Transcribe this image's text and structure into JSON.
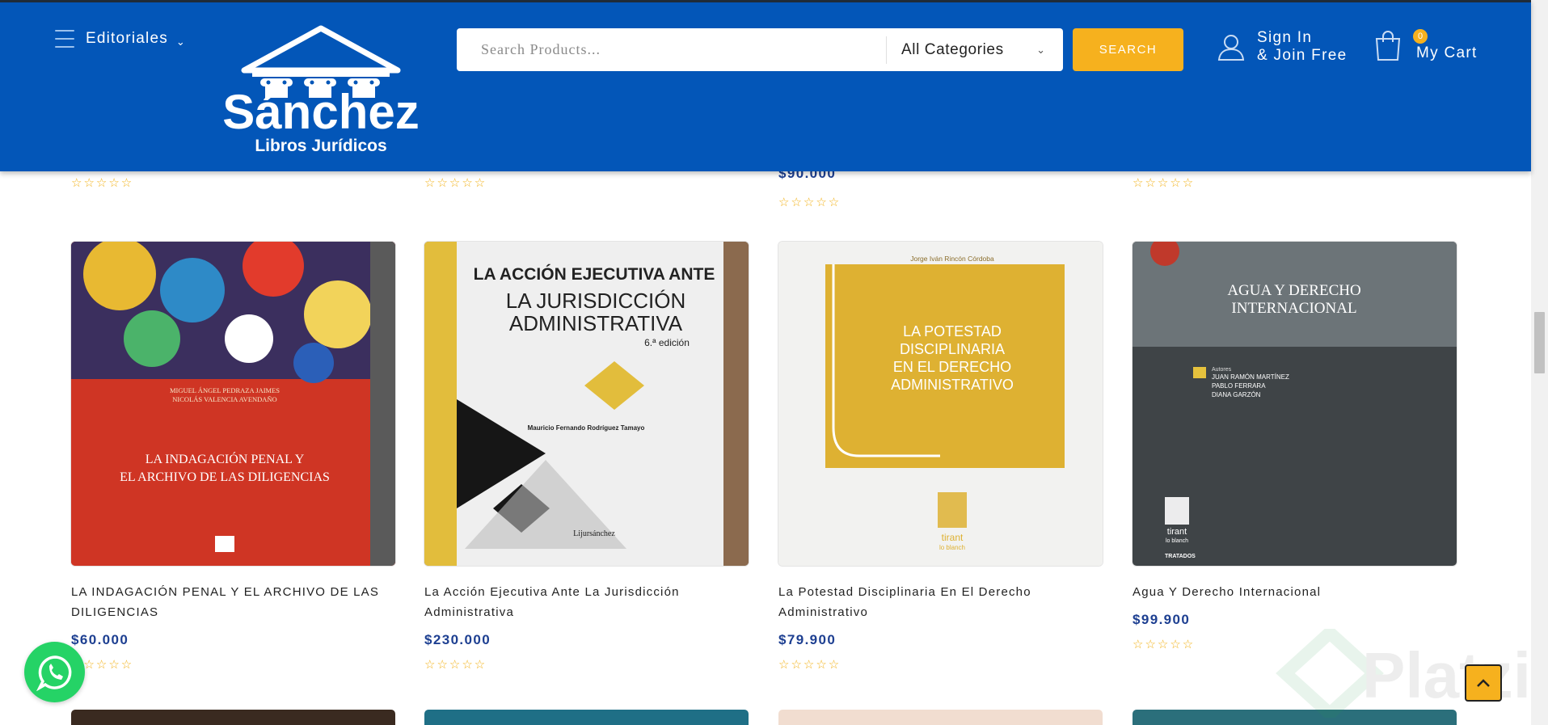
{
  "header": {
    "menu_label": "Editoriales",
    "logo": {
      "name": "Sánchez",
      "subtitle": "Libros Jurídicos"
    },
    "search_placeholder": "Search Products...",
    "category_selected": "All Categories",
    "search_button": "SEARCH",
    "account_line1": "Sign In",
    "account_line2": "& Join Free",
    "cart_count": "0",
    "cart_label": "My Cart",
    "colors": {
      "header_bg": "#0356b8",
      "accent": "#f6b11e",
      "price": "#1d3f91"
    }
  },
  "previous_row": {
    "price_visible": "$90.000",
    "rating_glyph": "☆☆☆☆☆"
  },
  "products": [
    {
      "title": "LA INDAGACIÓN PENAL Y EL ARCHIVO DE LAS DILIGENCIAS",
      "price": "$60.000",
      "rating": "☆☆☆☆☆",
      "cover_text": {
        "authors": "MIGUEL ÁNGEL PEDRAZA JAIMES\nNICOLÁS VALENCIA AVENDAÑO",
        "title": "LA INDAGACIÓN PENAL Y\nEL ARCHIVO DE LAS DILIGENCIAS"
      }
    },
    {
      "title": "La Acción Ejecutiva Ante La Jurisdicción Administrativa",
      "price": "$230.000",
      "rating": "☆☆☆☆☆",
      "cover_text": {
        "top": "LA ACCIÓN EJECUTIVA ANTE",
        "main": "LA JURISDICCIÓN\nADMINISTRATIVA",
        "edition": "6.ª edición",
        "author": "Mauricio Fernando Rodríguez Tamayo",
        "publisher": "Lijursánchez"
      }
    },
    {
      "title": "La Potestad Disciplinaria En El Derecho Administrativo",
      "price": "$79.900",
      "rating": "☆☆☆☆☆",
      "cover_text": {
        "author": "Jorge Iván Rincón Córdoba",
        "main": "LA POTESTAD\nDISCIPLINARIA\nEN EL DERECHO\nADMINISTRATIVO",
        "publisher": "tirant\nlo blanch"
      }
    },
    {
      "title": "Agua Y Derecho Internacional",
      "price": "$99.900",
      "rating": "☆☆☆☆☆",
      "cover_text": {
        "main": "AGUA Y DERECHO\nINTERNACIONAL",
        "authors": "Autores\nJUAN RAMÓN MARTÍNEZ\nPABLO FERRARA\nDIANA GARZÓN",
        "publisher": "tirant\nlo blanch",
        "series": "TRATADOS"
      }
    }
  ],
  "floating": {
    "watermark": "Platzi"
  }
}
